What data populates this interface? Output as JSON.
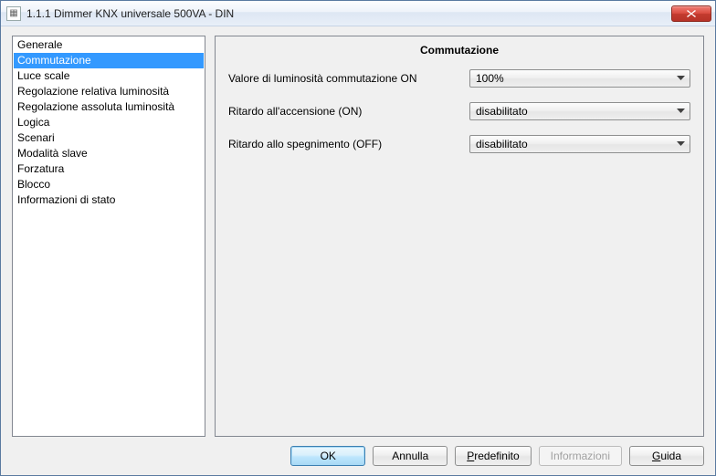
{
  "window": {
    "title": "1.1.1 Dimmer KNX universale 500VA - DIN"
  },
  "sidebar": {
    "selectedIndex": 1,
    "items": [
      {
        "label": "Generale"
      },
      {
        "label": "Commutazione"
      },
      {
        "label": "Luce scale"
      },
      {
        "label": "Regolazione relativa luminosità"
      },
      {
        "label": "Regolazione assoluta luminosità"
      },
      {
        "label": "Logica"
      },
      {
        "label": "Scenari"
      },
      {
        "label": "Modalità slave"
      },
      {
        "label": "Forzatura"
      },
      {
        "label": "Blocco"
      },
      {
        "label": "Informazioni di stato"
      }
    ]
  },
  "main": {
    "heading": "Commutazione",
    "rows": [
      {
        "label": "Valore di luminosità commutazione ON",
        "value": "100%"
      },
      {
        "label": "Ritardo all'accensione (ON)",
        "value": "disabilitato"
      },
      {
        "label": "Ritardo allo spegnimento (OFF)",
        "value": "disabilitato"
      }
    ]
  },
  "buttons": {
    "ok": {
      "label": "OK",
      "mnemonicIndex": -1
    },
    "cancel": {
      "label": "Annulla",
      "mnemonicIndex": -1
    },
    "default": {
      "label": "Predefinito",
      "mnemonicIndex": 0
    },
    "info": {
      "label": "Informazioni",
      "mnemonicIndex": -1,
      "disabled": true
    },
    "help": {
      "label": "Guida",
      "mnemonicIndex": 0
    }
  }
}
